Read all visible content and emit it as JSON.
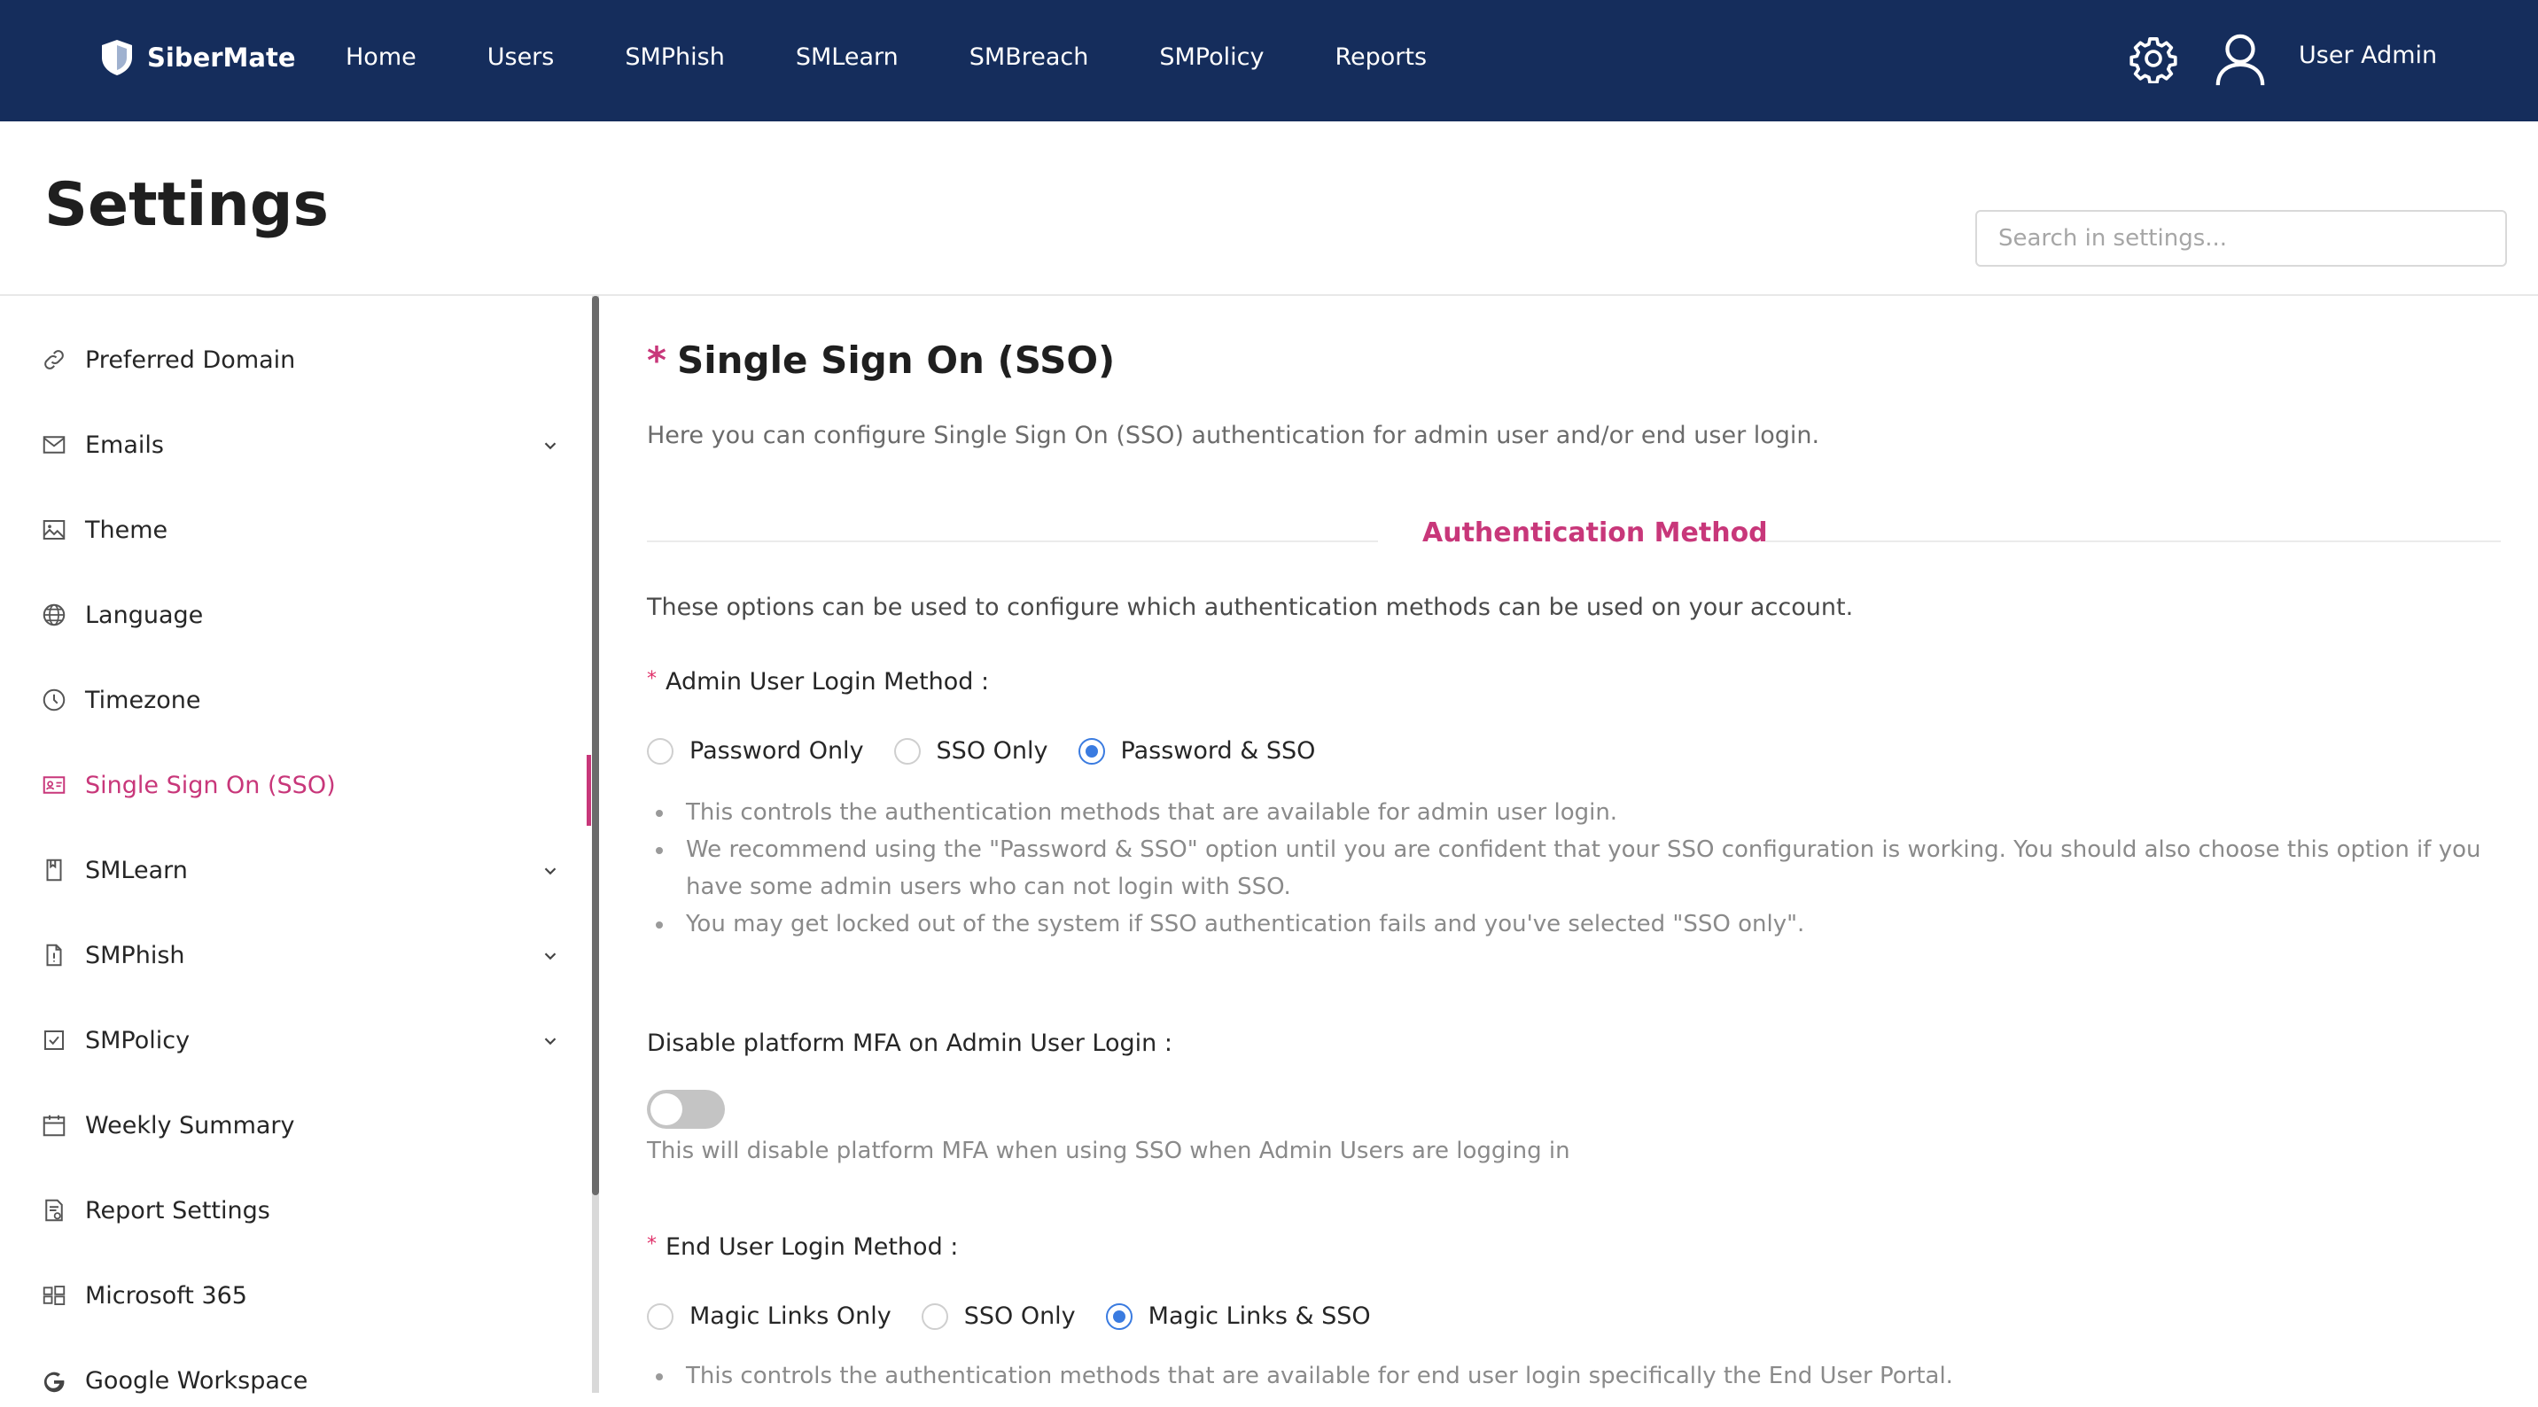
{
  "brand": {
    "name": "SiberMate"
  },
  "nav": {
    "items": [
      "Home",
      "Users",
      "SMPhish",
      "SMLearn",
      "SMBreach",
      "SMPolicy",
      "Reports"
    ],
    "user_name": "User Admin"
  },
  "page": {
    "title": "Settings",
    "search_placeholder": "Search in settings..."
  },
  "sidebar": {
    "items": [
      {
        "label": "Preferred Domain",
        "icon": "link-icon",
        "expandable": false
      },
      {
        "label": "Emails",
        "icon": "mail-icon",
        "expandable": true
      },
      {
        "label": "Theme",
        "icon": "image-icon",
        "expandable": false
      },
      {
        "label": "Language",
        "icon": "globe-icon",
        "expandable": false
      },
      {
        "label": "Timezone",
        "icon": "clock-icon",
        "expandable": false
      },
      {
        "label": "Single Sign On (SSO)",
        "icon": "id-card-icon",
        "expandable": false,
        "active": true
      },
      {
        "label": "SMLearn",
        "icon": "book-icon",
        "expandable": true
      },
      {
        "label": "SMPhish",
        "icon": "file-icon",
        "expandable": true
      },
      {
        "label": "SMPolicy",
        "icon": "checkbox-icon",
        "expandable": true
      },
      {
        "label": "Weekly Summary",
        "icon": "calendar-icon",
        "expandable": false
      },
      {
        "label": "Report Settings",
        "icon": "report-icon",
        "expandable": false
      },
      {
        "label": "Microsoft 365",
        "icon": "windows-icon",
        "expandable": false
      },
      {
        "label": "Google Workspace",
        "icon": "google-icon",
        "expandable": false
      }
    ]
  },
  "sso": {
    "title_marker": "*",
    "title": "Single Sign On (SSO)",
    "description": "Here you can configure Single Sign On (SSO) authentication for admin user and/or end user login.",
    "divider_title": "Authentication Method",
    "intro": "These options can be used to configure which authentication methods can be used on your account.",
    "admin": {
      "label": "Admin User Login Method",
      "required_marker": "*",
      "options": [
        "Password Only",
        "SSO Only",
        "Password & SSO"
      ],
      "selected": "Password & SSO",
      "notes": [
        "This controls the authentication methods that are available for admin user login.",
        "We recommend using the \"Password & SSO\" option until you are confident that your SSO configuration is working. You should also choose this option if you have some admin users who can not login with SSO.",
        "You may get locked out of the system if SSO authentication fails and you've selected \"SSO only\"."
      ]
    },
    "mfa": {
      "label": "Disable platform MFA on Admin User Login",
      "enabled": false,
      "hint": "This will disable platform MFA when using SSO when Admin Users are logging in"
    },
    "end_user": {
      "label": "End User Login Method",
      "required_marker": "*",
      "options": [
        "Magic Links Only",
        "SSO Only",
        "Magic Links & SSO"
      ],
      "selected": "Magic Links & SSO",
      "notes": [
        "This controls the authentication methods that are available for end user login specifically the End User Portal."
      ]
    }
  },
  "colors": {
    "nav_bg": "#152d5c",
    "accent": "#c8377a",
    "radio_selected": "#3a7be0"
  }
}
